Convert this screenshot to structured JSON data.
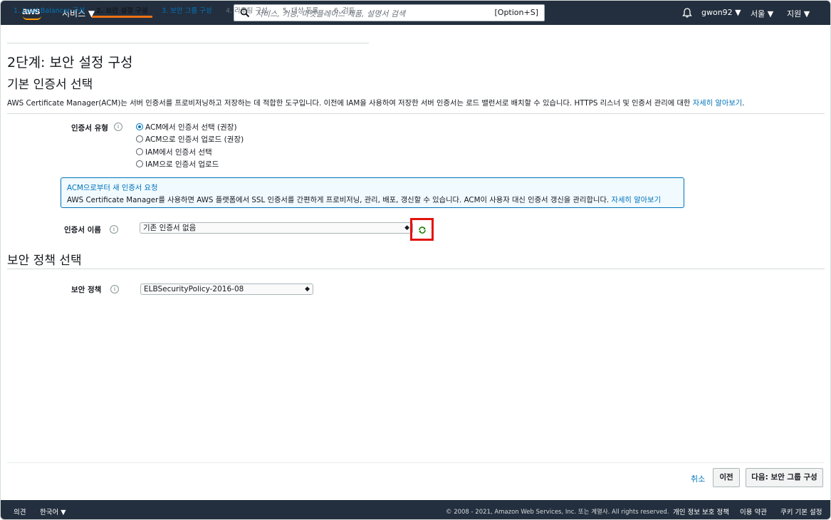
{
  "topnav": {
    "logo": "aws",
    "services": "서비스 ▼",
    "search_placeholder": "서비스, 기능, 마켓플레이스 제품, 설명서 검색",
    "search_shortcut": "[Option+S]",
    "user": "gwon92 ▼",
    "region": "서울 ▼",
    "support": "지원 ▼"
  },
  "tabs": [
    "1. Load Balancer 구성",
    "2. 보안 설정 구성",
    "3. 보안 그룹 구성",
    "4. 라우팅 구성",
    "5. 대상 등록",
    "6. 검토"
  ],
  "page_title": "2단계: 보안 설정 구성",
  "cert_section": {
    "title": "기본 인증서 선택",
    "description": "AWS Certificate Manager(ACM)는 서버 인증서를 프로비저닝하고 저장하는 데 적합한 도구입니다. 이전에 IAM을 사용하여 저장한 서버 인증서는 로드 밸런서로 배치할 수 있습니다. HTTPS 리스너 및 인증서 관리에 대한 ",
    "learn_more": "자세히 알아보기",
    "desc_end": ".",
    "cert_type_label": "인증서 유형",
    "options": [
      "ACM에서 인증서 선택 (권장)",
      "ACM으로 인증서 업로드 (권장)",
      "IAM에서 인증서 선택",
      "IAM으로 인증서 업로드"
    ],
    "selected_option": 0,
    "infobox_title": "ACM으로부터 새 인증서 요청",
    "infobox_body": "AWS Certificate Manager를 사용하면 AWS 플랫폼에서 SSL 인증서를 간편하게 프로비저닝, 관리, 배포, 갱신할 수 있습니다. ACM이 사용자 대신 인증서 갱신을 관리합니다. ",
    "infobox_link": "자세히 알아보기",
    "cert_name_label": "인증서 이름",
    "cert_name_value": "기존 인증서 없음"
  },
  "policy_section": {
    "title": "보안 정책 선택",
    "policy_label": "보안 정책",
    "policy_value": "ELBSecurityPolicy-2016-08"
  },
  "actions": {
    "cancel": "취소",
    "previous": "이전",
    "next": "다음: 보안 그룹 구성"
  },
  "bottombar": {
    "feedback": "의견",
    "language": "한국어 ▼",
    "copyright": "© 2008 - 2021, Amazon Web Services, Inc. 또는 계열사. All rights reserved.",
    "privacy": "개인 정보 보호 정책",
    "terms": "이용 약관",
    "cookies": "쿠키 기본 설정"
  },
  "colors": {
    "nav_bg": "#232f3e",
    "accent": "#ec7211",
    "link": "#0073bb",
    "highlight": "#e2130d"
  }
}
